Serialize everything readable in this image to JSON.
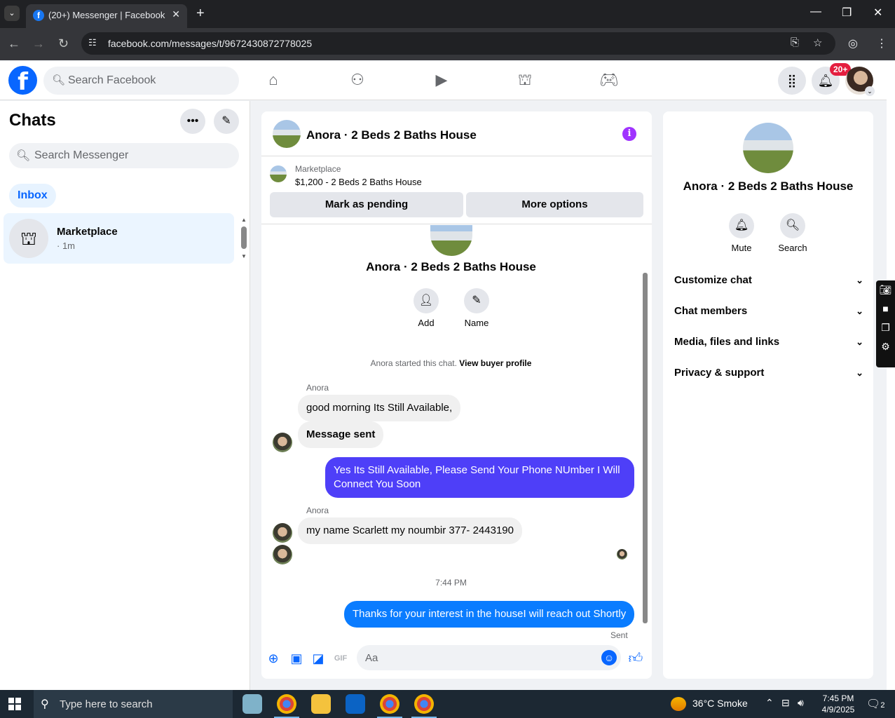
{
  "browser": {
    "tab_title": "(20+) Messenger | Facebook",
    "url": "facebook.com/messages/t/9672430872778025"
  },
  "fb": {
    "search_placeholder": "Search Facebook",
    "notif_badge": "20+"
  },
  "left": {
    "title": "Chats",
    "search_placeholder": "Search Messenger",
    "inbox_label": "Inbox",
    "chats": [
      {
        "name": "Marketplace",
        "time": "· 1m"
      }
    ]
  },
  "conversation": {
    "title": "Anora · 2 Beds 2 Baths House",
    "marketplace_label": "Marketplace",
    "listing": "$1,200 - 2 Beds 2 Baths House",
    "mark_pending": "Mark as pending",
    "more_options": "More options",
    "thread_title": "Anora · 2 Beds 2 Baths House",
    "add_label": "Add",
    "name_label": "Name",
    "started": "Anora started this chat.",
    "view_buyer": "View buyer profile",
    "messages": [
      {
        "sender": "Anora",
        "text": "good morning Its Still Available,"
      },
      {
        "text": "Message sent"
      },
      {
        "text": "Yes Its Still Available, Please Send Your Phone NUmber I Will Connect You Soon"
      },
      {
        "sender": "Anora",
        "text": "my name Scarlett my noumbir 377- 2443190"
      },
      {
        "text": "Thanks for your interest in the houseI will reach out Shortly"
      }
    ],
    "time_separator": "7:44 PM",
    "sent_label": "Sent",
    "composer_placeholder": "Aa"
  },
  "right": {
    "title": "Anora · 2 Beds 2 Baths House",
    "mute_label": "Mute",
    "search_label": "Search",
    "sections": [
      "Customize chat",
      "Chat members",
      "Media, files and links",
      "Privacy & support"
    ]
  },
  "taskbar": {
    "search_placeholder": "Type here to search",
    "weather": "36°C  Smoke",
    "time": "7:45 PM",
    "date": "4/9/2025",
    "notif_count": "2"
  }
}
